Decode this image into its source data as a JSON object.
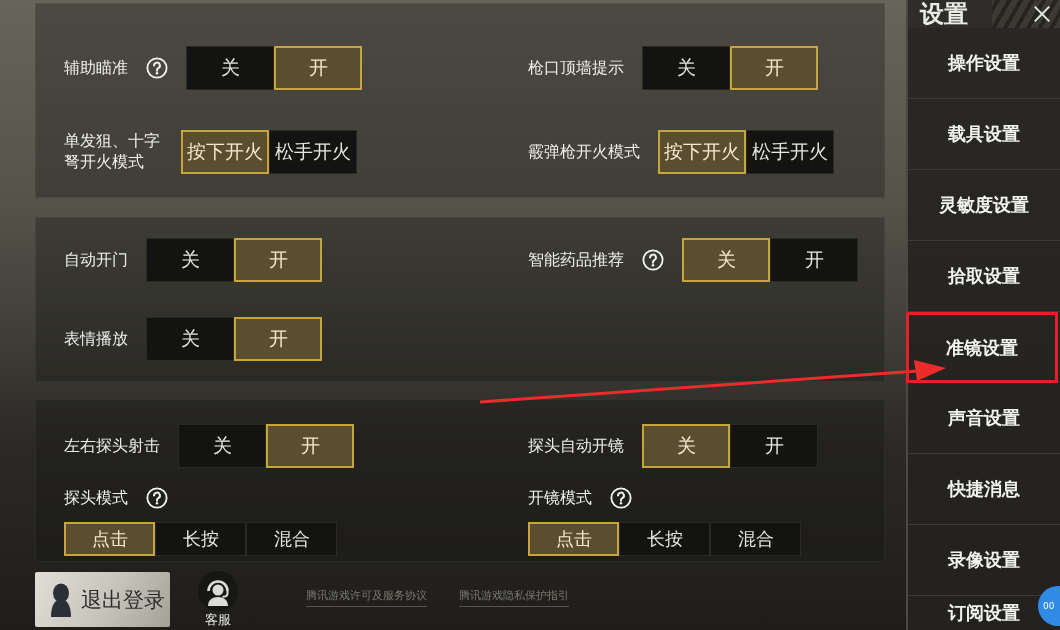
{
  "panels": [
    {
      "rows": [
        {
          "settings": [
            {
              "label": "辅助瞄准",
              "help": true,
              "kind": "inline",
              "options": [
                {
                  "label": "关",
                  "selected": false
                },
                {
                  "label": "开",
                  "selected": true
                }
              ]
            },
            {
              "label": "枪口顶墙提示",
              "kind": "inline",
              "options": [
                {
                  "label": "关",
                  "selected": false
                },
                {
                  "label": "开",
                  "selected": true
                }
              ]
            }
          ]
        },
        {
          "settings": [
            {
              "label": "单发狙、十字弩开火模式",
              "kind": "inline",
              "options": [
                {
                  "label": "按下开火",
                  "selected": true
                },
                {
                  "label": "松手开火",
                  "selected": false
                }
              ]
            },
            {
              "label": "霰弹枪开火模式",
              "kind": "inline",
              "options": [
                {
                  "label": "按下开火",
                  "selected": true
                },
                {
                  "label": "松手开火",
                  "selected": false
                }
              ]
            }
          ]
        }
      ]
    },
    {
      "rows": [
        {
          "settings": [
            {
              "label": "自动开门",
              "kind": "inline",
              "options": [
                {
                  "label": "关",
                  "selected": false
                },
                {
                  "label": "开",
                  "selected": true
                }
              ]
            },
            {
              "label": "智能药品推荐",
              "help": true,
              "kind": "inline",
              "options": [
                {
                  "label": "关",
                  "selected": true
                },
                {
                  "label": "开",
                  "selected": false
                }
              ]
            }
          ]
        },
        {
          "settings": [
            {
              "label": "表情播放",
              "kind": "inline",
              "options": [
                {
                  "label": "关",
                  "selected": false
                },
                {
                  "label": "开",
                  "selected": true
                }
              ]
            }
          ]
        }
      ]
    },
    {
      "rows": [
        {
          "settings": [
            {
              "label": "左右探头射击",
              "kind": "inline",
              "options": [
                {
                  "label": "关",
                  "selected": false
                },
                {
                  "label": "开",
                  "selected": true
                }
              ]
            },
            {
              "label": "探头自动开镜",
              "kind": "inline",
              "options": [
                {
                  "label": "关",
                  "selected": true
                },
                {
                  "label": "开",
                  "selected": false
                }
              ]
            }
          ]
        },
        {
          "settings": [
            {
              "label": "探头模式",
              "help": true,
              "kind": "stacked",
              "options": [
                {
                  "label": "点击",
                  "selected": true
                },
                {
                  "label": "长按",
                  "selected": false
                },
                {
                  "label": "混合",
                  "selected": false
                }
              ]
            },
            {
              "label": "开镜模式",
              "help": true,
              "kind": "stacked",
              "options": [
                {
                  "label": "点击",
                  "selected": true
                },
                {
                  "label": "长按",
                  "selected": false
                },
                {
                  "label": "混合",
                  "selected": false
                }
              ]
            }
          ]
        }
      ]
    }
  ],
  "footer": {
    "logout_button": "退出登录",
    "support": "客服",
    "links": [
      "腾讯游戏许可及服务协议",
      "腾讯游戏隐私保护指引"
    ]
  },
  "sidebar": {
    "title": "设置",
    "items": [
      {
        "label": "操作设置",
        "highlighted": false
      },
      {
        "label": "载具设置",
        "highlighted": false
      },
      {
        "label": "灵敏度设置",
        "highlighted": false
      },
      {
        "label": "拾取设置",
        "highlighted": false
      },
      {
        "label": "准镜设置",
        "highlighted": true
      },
      {
        "label": "声音设置",
        "highlighted": false
      },
      {
        "label": "快捷消息",
        "highlighted": false
      },
      {
        "label": "录像设置",
        "highlighted": false
      },
      {
        "label": "订阅设置",
        "highlighted": false
      }
    ]
  },
  "bubble": "00"
}
